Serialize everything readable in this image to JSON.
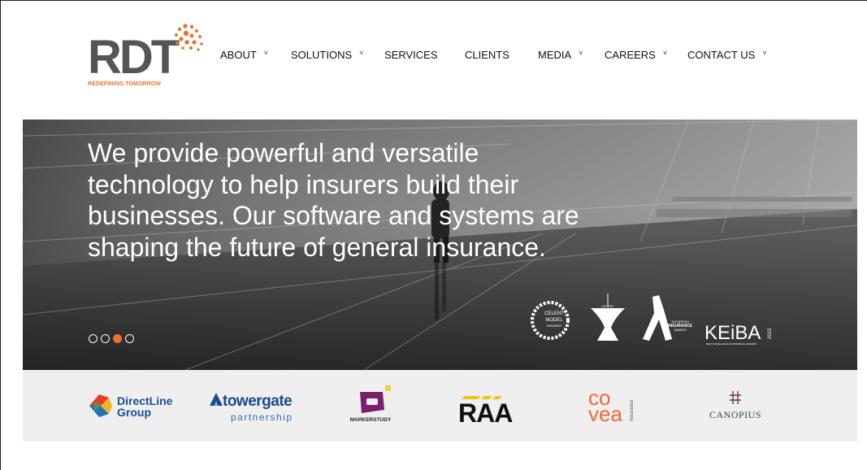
{
  "brand": {
    "logo_text": "RDT",
    "tagline": "REDEFINING TOMORROW",
    "accent_color": "#e8742c"
  },
  "nav": {
    "items": [
      {
        "label": "ABOUT",
        "dropdown": true
      },
      {
        "label": "SOLUTIONS",
        "dropdown": true
      },
      {
        "label": "SERVICES",
        "dropdown": false
      },
      {
        "label": "CLIENTS",
        "dropdown": false
      },
      {
        "label": "MEDIA",
        "dropdown": true
      },
      {
        "label": "CAREERS",
        "dropdown": true
      },
      {
        "label": "CONTACT US",
        "dropdown": true
      }
    ],
    "dropdown_glyph": "˅"
  },
  "hero": {
    "lines": [
      "We provide powerful and versatile",
      "technology to help insurers build their",
      "businesses. Our software and systems are",
      "shaping the future of general insurance."
    ],
    "slides_total": 4,
    "active_slide": 3,
    "awards": {
      "celent_model": [
        "CELENT",
        "MODEL",
        "INSURER"
      ],
      "celent_small": "CELENT",
      "british": [
        "THE BRITISH",
        "INSURANCE",
        "AWARDS"
      ],
      "keiba": "KEiBA",
      "keiba_year": "2015",
      "keiba_sub": "BEST EXCELLENCE IN BUSINESS AWARDS"
    }
  },
  "clients": {
    "directline": [
      "DirectLine",
      "Group"
    ],
    "towergate": [
      "towergate",
      "partnership"
    ],
    "markerstudy": "MARKERSTUDY",
    "raa": "RAA",
    "covea": [
      "co",
      "vea",
      "Insurance"
    ],
    "canopius": "CANOPIUS"
  }
}
